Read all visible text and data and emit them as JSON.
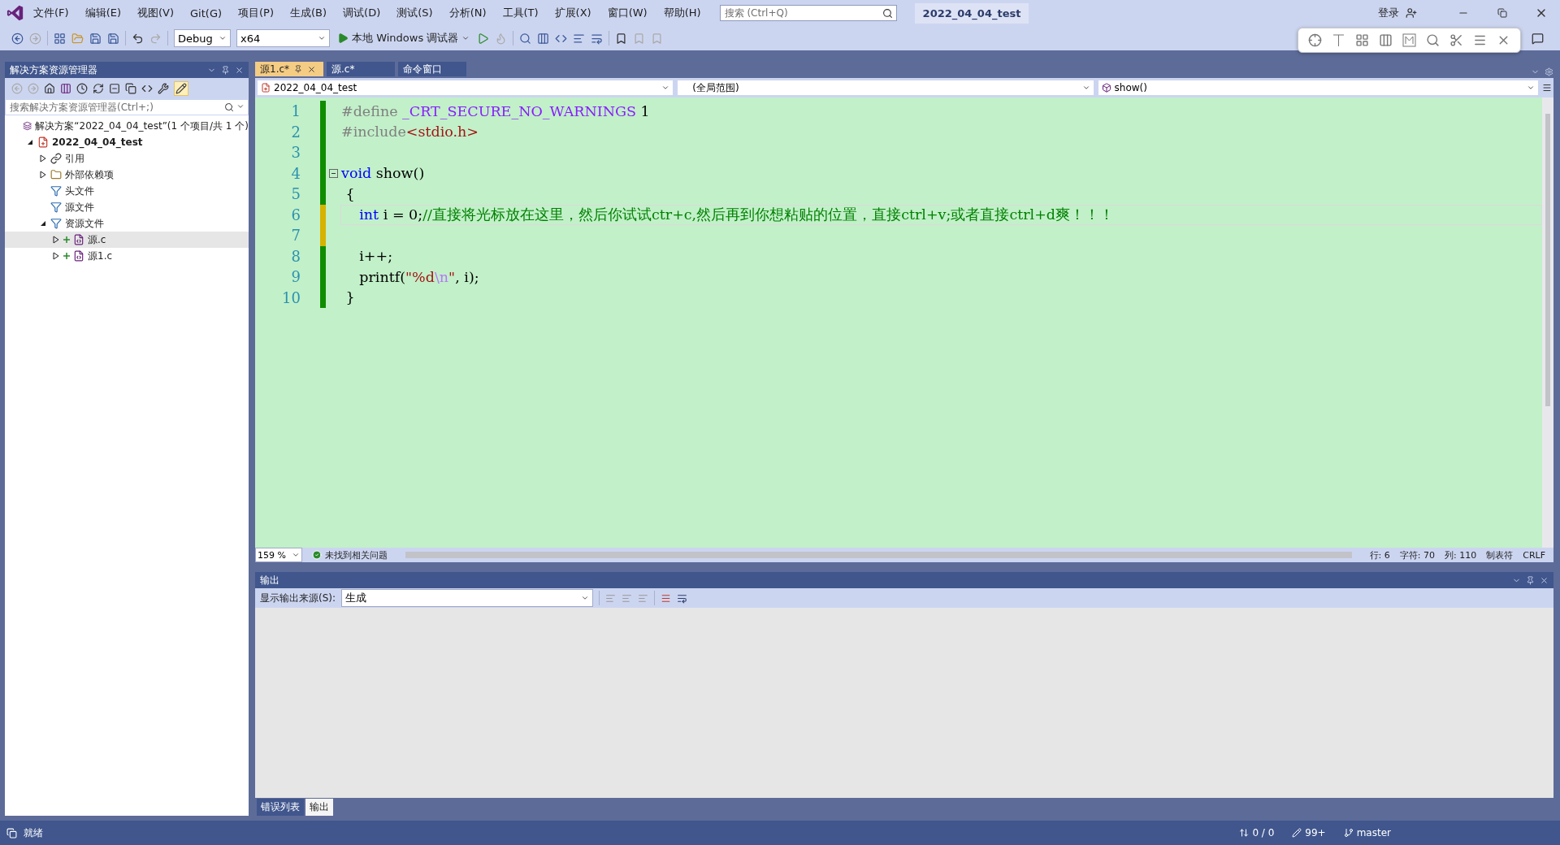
{
  "menu": [
    "文件(F)",
    "编辑(E)",
    "视图(V)",
    "Git(G)",
    "项目(P)",
    "生成(B)",
    "调试(D)",
    "测试(S)",
    "分析(N)",
    "工具(T)",
    "扩展(X)",
    "窗口(W)",
    "帮助(H)"
  ],
  "search": {
    "placeholder": "搜索 (Ctrl+Q)"
  },
  "window": {
    "title": "2022_04_04_test",
    "login": "登录"
  },
  "toolbar": {
    "configuration": "Debug",
    "platform": "x64",
    "run": "本地 Windows 调试器"
  },
  "solution_explorer": {
    "title": "解决方案资源管理器",
    "search": {
      "placeholder": "搜索解决方案资源管理器(Ctrl+;)"
    },
    "tree": [
      {
        "label": "解决方案“2022_04_04_test”(1 个项目/共 1 个)",
        "kind": "solution",
        "selected": false,
        "children": [
          {
            "label": "2022_04_04_test",
            "kind": "project",
            "expanded": true,
            "selected": false,
            "children": [
              {
                "label": "引用",
                "kind": "references",
                "expanded": false,
                "selected": false
              },
              {
                "label": "外部依赖项",
                "kind": "dependencies",
                "expanded": false,
                "selected": false
              },
              {
                "label": "头文件",
                "kind": "filter",
                "selected": false
              },
              {
                "label": "源文件",
                "kind": "filter",
                "selected": false
              },
              {
                "label": "资源文件",
                "kind": "filter",
                "expanded": true,
                "selected": false,
                "children": [
                  {
                    "label": "源.c",
                    "kind": "file",
                    "expanded": false,
                    "added": true,
                    "selected": true
                  },
                  {
                    "label": "源1.c",
                    "kind": "file",
                    "expanded": false,
                    "added": true,
                    "selected": false
                  }
                ]
              }
            ]
          }
        ]
      }
    ]
  },
  "editor": {
    "tabs": [
      {
        "label": "源1.c*",
        "selected": true
      },
      {
        "label": "源.c*",
        "selected": false
      },
      {
        "label": "命令窗口",
        "selected": false
      }
    ],
    "navigation": {
      "project": "2022_04_04_test",
      "scope": "(全局范围)",
      "member": "show()"
    },
    "lines": [
      {
        "number": "1",
        "saved": true,
        "current": false,
        "tokens": [
          {
            "kind": "preproc",
            "text": "#define"
          },
          {
            "kind": "macro",
            "text": " _CRT_SECURE_NO_WARNINGS"
          },
          {
            "kind": "plain",
            "text": " 1"
          }
        ]
      },
      {
        "number": "2",
        "saved": true,
        "current": false,
        "tokens": [
          {
            "kind": "preproc",
            "text": "#include"
          },
          {
            "kind": "string",
            "text": "<stdio.h>"
          }
        ]
      },
      {
        "number": "3",
        "saved": true,
        "current": false
      },
      {
        "number": "4",
        "saved": true,
        "current": false,
        "fold": true,
        "tokens": [
          {
            "kind": "keyword",
            "text": "void"
          },
          {
            "kind": "plain",
            "text": " show()"
          }
        ]
      },
      {
        "number": "5",
        "saved": true,
        "current": false,
        "tokens": [
          {
            "kind": "plain",
            "text": " {"
          }
        ]
      },
      {
        "number": "6",
        "saved": false,
        "current": true,
        "tokens": [
          {
            "kind": "keyword",
            "text": "    int"
          },
          {
            "kind": "plain",
            "text": " i = 0;"
          },
          {
            "kind": "comment",
            "text": "//直接将光标放在这里，然后你试试ctr+c,然后再到你想粘贴的位置，直接ctrl+v;或者直接ctrl+d爽！！！"
          }
        ]
      },
      {
        "number": "7",
        "saved": false,
        "current": false
      },
      {
        "number": "8",
        "saved": true,
        "current": false,
        "tokens": [
          {
            "kind": "plain",
            "text": "    i++;"
          }
        ]
      },
      {
        "number": "9",
        "saved": true,
        "current": false,
        "tokens": [
          {
            "kind": "plain",
            "text": "    printf("
          },
          {
            "kind": "string",
            "text": "\"%d"
          },
          {
            "kind": "escape",
            "text": "\\n"
          },
          {
            "kind": "string",
            "text": "\""
          },
          {
            "kind": "plain",
            "text": ", i);"
          }
        ]
      },
      {
        "number": "10",
        "saved": true,
        "current": false,
        "tokens": [
          {
            "kind": "plain",
            "text": " }"
          }
        ]
      }
    ],
    "status": {
      "zoom": "159 %",
      "issues": "未找到相关问题",
      "line": "行: 6",
      "char": "字符: 70",
      "column": "列: 110",
      "indent": "制表符",
      "eol": "CRLF"
    }
  },
  "output": {
    "title": "输出",
    "source_label": "显示输出来源(S):",
    "source": "生成",
    "tabs": [
      {
        "label": "错误列表",
        "selected": false
      },
      {
        "label": "输出",
        "selected": true
      }
    ]
  },
  "status_bar": {
    "state": "就绪",
    "sync": "0 / 0",
    "changes": "99+",
    "branch": "master"
  }
}
